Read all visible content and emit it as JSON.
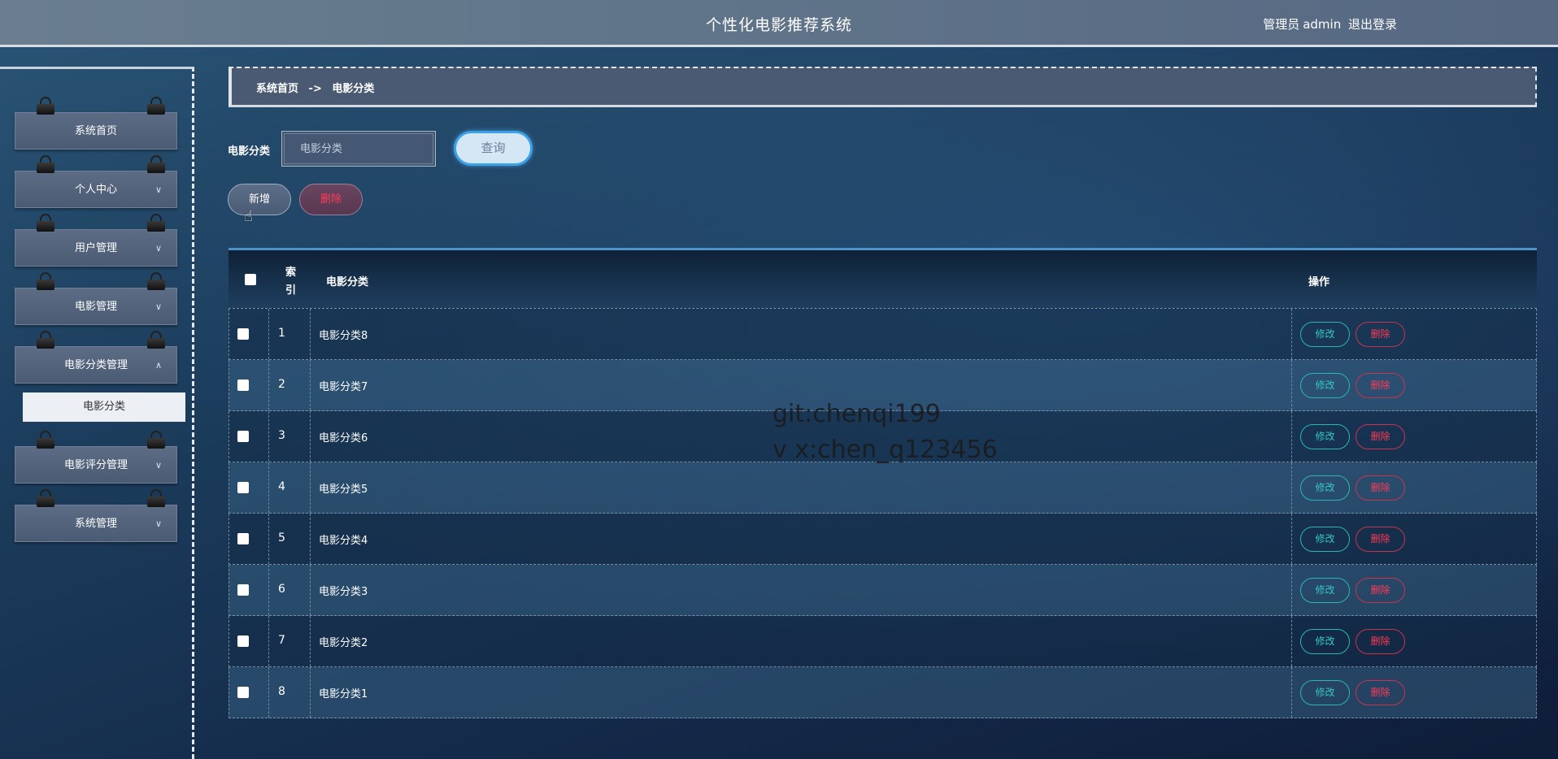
{
  "header": {
    "title": "个性化电影推荐系统",
    "role": "管理员",
    "username": "admin",
    "logout": "退出登录"
  },
  "sidebar": {
    "items": [
      {
        "label": "系统首页",
        "chevron": ""
      },
      {
        "label": "个人中心",
        "chevron": "∨"
      },
      {
        "label": "用户管理",
        "chevron": "∨"
      },
      {
        "label": "电影管理",
        "chevron": "∨"
      },
      {
        "label": "电影分类管理",
        "chevron": "∧"
      },
      {
        "label": "电影评分管理",
        "chevron": "∨"
      },
      {
        "label": "系统管理",
        "chevron": "∨"
      }
    ],
    "sub_item": "电影分类"
  },
  "breadcrumb": {
    "home": "系统首页",
    "separator": "->",
    "current": "电影分类"
  },
  "search": {
    "label": "电影分类",
    "placeholder": "电影分类",
    "button": "查询"
  },
  "toolbar": {
    "add": "新增",
    "delete": "删除"
  },
  "table": {
    "headers": {
      "index": "索引",
      "name": "电影分类",
      "op": "操作"
    },
    "edit_label": "修改",
    "delete_label": "删除",
    "rows": [
      {
        "index": "1",
        "name": "电影分类8"
      },
      {
        "index": "2",
        "name": "电影分类7"
      },
      {
        "index": "3",
        "name": "电影分类6"
      },
      {
        "index": "4",
        "name": "电影分类5"
      },
      {
        "index": "5",
        "name": "电影分类4"
      },
      {
        "index": "6",
        "name": "电影分类3"
      },
      {
        "index": "7",
        "name": "电影分类2"
      },
      {
        "index": "8",
        "name": "电影分类1"
      }
    ]
  },
  "watermark": {
    "line1": "git:chenqi199",
    "line2": "v x:chen_q123456"
  },
  "colors": {
    "edit": "#35c6c4",
    "delete": "#ff3a55",
    "accent": "#3aa3e8"
  }
}
